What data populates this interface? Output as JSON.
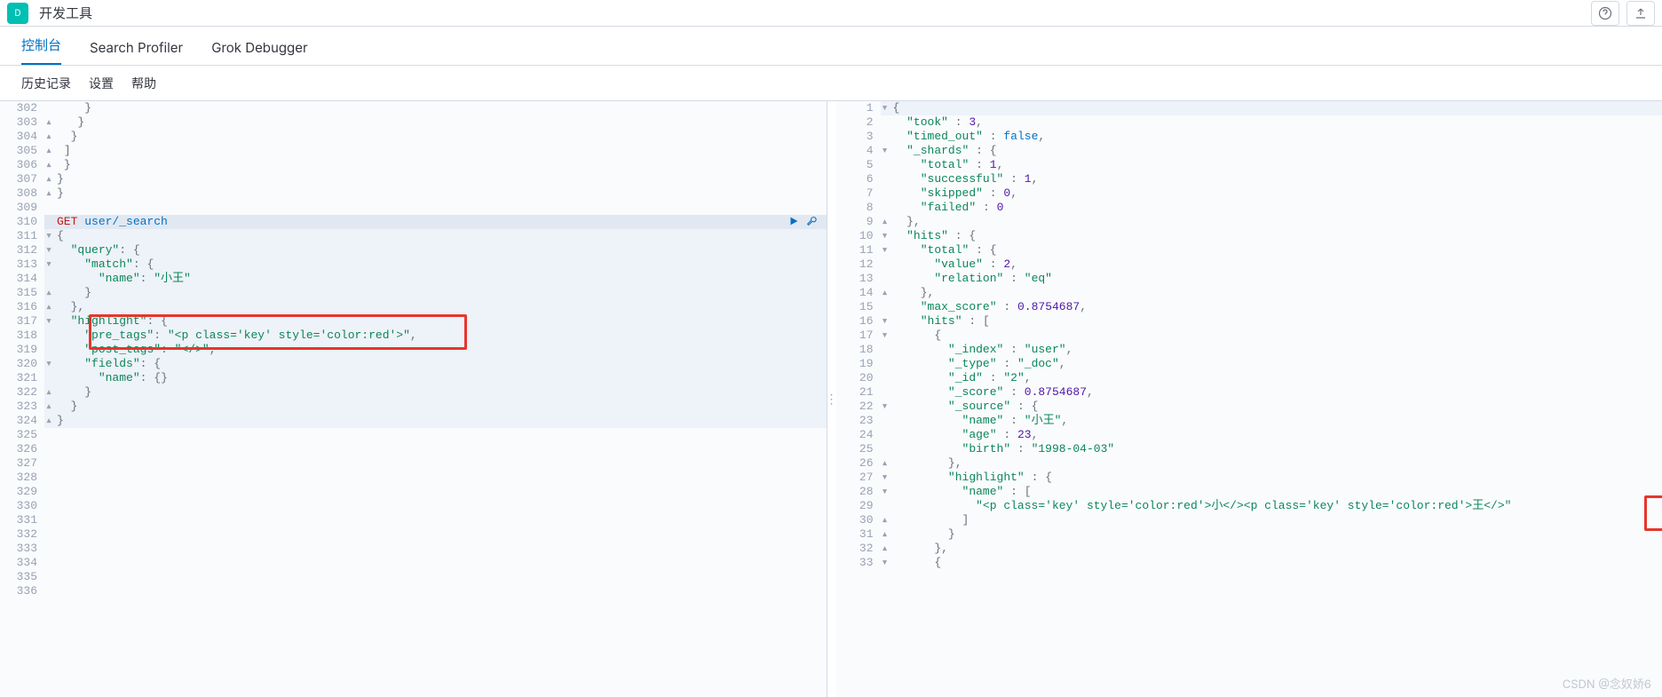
{
  "header": {
    "appTitle": "开发工具"
  },
  "tabs": [
    {
      "label": "控制台",
      "active": true
    },
    {
      "label": "Search Profiler",
      "active": false
    },
    {
      "label": "Grok Debugger",
      "active": false
    }
  ],
  "subbar": {
    "history": "历史记录",
    "settings": "设置",
    "help": "帮助"
  },
  "leftEditor": {
    "startLine": 302,
    "lines": [
      {
        "n": 302,
        "fold": "",
        "txt": "    }"
      },
      {
        "n": 303,
        "fold": "▴",
        "txt": "   }"
      },
      {
        "n": 304,
        "fold": "▴",
        "txt": "  }"
      },
      {
        "n": 305,
        "fold": "▴",
        "txt": " ]"
      },
      {
        "n": 306,
        "fold": "▴",
        "txt": " }"
      },
      {
        "n": 307,
        "fold": "▴",
        "txt": "}"
      },
      {
        "n": 308,
        "fold": "▴",
        "txt": "}"
      },
      {
        "n": 309,
        "fold": "",
        "txt": ""
      },
      {
        "n": 310,
        "fold": "",
        "txt": "GET user/_search",
        "active": true,
        "isReq": true
      },
      {
        "n": 311,
        "fold": "▾",
        "txt": "{",
        "block": true
      },
      {
        "n": 312,
        "fold": "▾",
        "txt": "  \"query\": {",
        "block": true
      },
      {
        "n": 313,
        "fold": "▾",
        "txt": "    \"match\": {",
        "block": true
      },
      {
        "n": 314,
        "fold": "",
        "txt": "      \"name\": \"小王\"",
        "block": true
      },
      {
        "n": 315,
        "fold": "▴",
        "txt": "    }",
        "block": true
      },
      {
        "n": 316,
        "fold": "▴",
        "txt": "  },",
        "block": true
      },
      {
        "n": 317,
        "fold": "▾",
        "txt": "  \"highlight\": {",
        "block": true
      },
      {
        "n": 318,
        "fold": "",
        "txt": "    \"pre_tags\": \"<p class='key' style='color:red'>\",",
        "block": true
      },
      {
        "n": 319,
        "fold": "",
        "txt": "    \"post_tags\": \"</>\",",
        "block": true
      },
      {
        "n": 320,
        "fold": "▾",
        "txt": "    \"fields\": {",
        "block": true
      },
      {
        "n": 321,
        "fold": "",
        "txt": "      \"name\": {}",
        "block": true
      },
      {
        "n": 322,
        "fold": "▴",
        "txt": "    }",
        "block": true
      },
      {
        "n": 323,
        "fold": "▴",
        "txt": "  }",
        "block": true
      },
      {
        "n": 324,
        "fold": "▴",
        "txt": "}",
        "block": true
      },
      {
        "n": 325,
        "fold": "",
        "txt": ""
      },
      {
        "n": 326,
        "fold": "",
        "txt": ""
      },
      {
        "n": 327,
        "fold": "",
        "txt": ""
      },
      {
        "n": 328,
        "fold": "",
        "txt": ""
      },
      {
        "n": 329,
        "fold": "",
        "txt": ""
      },
      {
        "n": 330,
        "fold": "",
        "txt": ""
      },
      {
        "n": 331,
        "fold": "",
        "txt": ""
      },
      {
        "n": 332,
        "fold": "",
        "txt": ""
      },
      {
        "n": 333,
        "fold": "",
        "txt": ""
      },
      {
        "n": 334,
        "fold": "",
        "txt": ""
      },
      {
        "n": 335,
        "fold": "",
        "txt": ""
      },
      {
        "n": 336,
        "fold": "",
        "txt": ""
      }
    ]
  },
  "rightEditor": {
    "lines": [
      {
        "n": 1,
        "fold": "▾",
        "txt": "{",
        "block": true
      },
      {
        "n": 2,
        "fold": "",
        "txt": "  \"took\" : 3,"
      },
      {
        "n": 3,
        "fold": "",
        "txt": "  \"timed_out\" : false,"
      },
      {
        "n": 4,
        "fold": "▾",
        "txt": "  \"_shards\" : {"
      },
      {
        "n": 5,
        "fold": "",
        "txt": "    \"total\" : 1,"
      },
      {
        "n": 6,
        "fold": "",
        "txt": "    \"successful\" : 1,"
      },
      {
        "n": 7,
        "fold": "",
        "txt": "    \"skipped\" : 0,"
      },
      {
        "n": 8,
        "fold": "",
        "txt": "    \"failed\" : 0"
      },
      {
        "n": 9,
        "fold": "▴",
        "txt": "  },"
      },
      {
        "n": 10,
        "fold": "▾",
        "txt": "  \"hits\" : {"
      },
      {
        "n": 11,
        "fold": "▾",
        "txt": "    \"total\" : {"
      },
      {
        "n": 12,
        "fold": "",
        "txt": "      \"value\" : 2,"
      },
      {
        "n": 13,
        "fold": "",
        "txt": "      \"relation\" : \"eq\""
      },
      {
        "n": 14,
        "fold": "▴",
        "txt": "    },"
      },
      {
        "n": 15,
        "fold": "",
        "txt": "    \"max_score\" : 0.8754687,"
      },
      {
        "n": 16,
        "fold": "▾",
        "txt": "    \"hits\" : ["
      },
      {
        "n": 17,
        "fold": "▾",
        "txt": "      {"
      },
      {
        "n": 18,
        "fold": "",
        "txt": "        \"_index\" : \"user\","
      },
      {
        "n": 19,
        "fold": "",
        "txt": "        \"_type\" : \"_doc\","
      },
      {
        "n": 20,
        "fold": "",
        "txt": "        \"_id\" : \"2\","
      },
      {
        "n": 21,
        "fold": "",
        "txt": "        \"_score\" : 0.8754687,"
      },
      {
        "n": 22,
        "fold": "▾",
        "txt": "        \"_source\" : {"
      },
      {
        "n": 23,
        "fold": "",
        "txt": "          \"name\" : \"小王\","
      },
      {
        "n": 24,
        "fold": "",
        "txt": "          \"age\" : 23,"
      },
      {
        "n": 25,
        "fold": "",
        "txt": "          \"birth\" : \"1998-04-03\""
      },
      {
        "n": 26,
        "fold": "▴",
        "txt": "        },"
      },
      {
        "n": 27,
        "fold": "▾",
        "txt": "        \"highlight\" : {"
      },
      {
        "n": 28,
        "fold": "▾",
        "txt": "          \"name\" : ["
      },
      {
        "n": 29,
        "fold": "",
        "txt": "            \"<p class='key' style='color:red'>小</><p class='key' style='color:red'>王</>\""
      },
      {
        "n": 30,
        "fold": "▴",
        "txt": "          ]"
      },
      {
        "n": 31,
        "fold": "▴",
        "txt": "        }"
      },
      {
        "n": 32,
        "fold": "▴",
        "txt": "      },"
      },
      {
        "n": 33,
        "fold": "▾",
        "txt": "      {"
      }
    ]
  },
  "watermark": "CSDN @念奴娇6"
}
